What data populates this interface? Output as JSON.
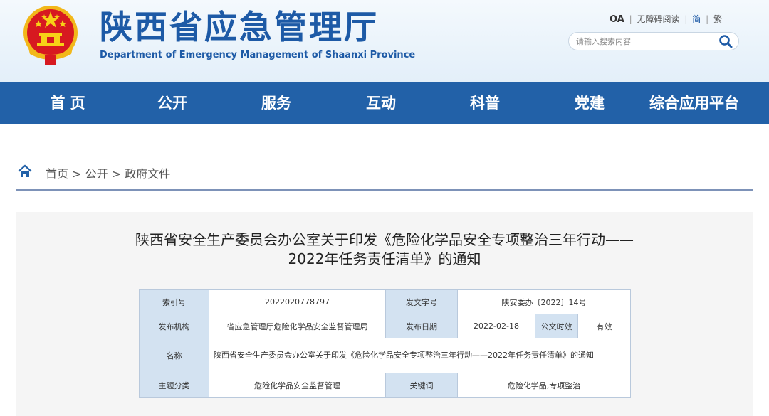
{
  "site": {
    "title_cn": "陕西省应急管理厅",
    "title_en": "Department of Emergency Management of Shaanxi Province"
  },
  "toplinks": {
    "oa": "OA",
    "accessibility": "无障碍阅读",
    "simplified": "简",
    "traditional": "繁"
  },
  "search": {
    "placeholder": "请输入搜索内容"
  },
  "nav": {
    "items": [
      "首 页",
      "公开",
      "服务",
      "互动",
      "科普",
      "党建",
      "综合应用平台"
    ]
  },
  "breadcrumb": {
    "home": "首页",
    "level2": "公开",
    "level3": "政府文件",
    "separator": ">"
  },
  "document": {
    "title_line1": "陕西省安全生产委员会办公室关于印发《危险化学品安全专项整治三年行动——",
    "title_line2": "2022年任务责任清单》的通知"
  },
  "info_table": {
    "index_label": "索引号",
    "index_value": "2022020778797",
    "doc_no_label": "发文字号",
    "doc_no_value": "陕安委办〔2022〕14号",
    "publisher_label": "发布机构",
    "publisher_value": "省应急管理厅危险化学品安全监督管理局",
    "date_label": "发布日期",
    "date_value": "2022-02-18",
    "validity_label": "公文时效",
    "validity_value": "有效",
    "name_label": "名称",
    "name_value": "陕西省安全生产委员会办公室关于印发《危险化学品安全专项整治三年行动——2022年任务责任清单》的通知",
    "topic_label": "主题分类",
    "topic_value": "危险化学品安全监督管理",
    "keywords_label": "关键词",
    "keywords_value": "危险化学品,专项整治"
  },
  "colors": {
    "brand_blue": "#1d5aa6",
    "nav_blue": "#2261a8",
    "table_label_bg": "#d3e2f1",
    "emblem_red": "#c8161d",
    "emblem_gold": "#f5c518"
  },
  "icons": {
    "emblem": "national-emblem-icon",
    "search": "search-icon",
    "home": "home-icon"
  }
}
